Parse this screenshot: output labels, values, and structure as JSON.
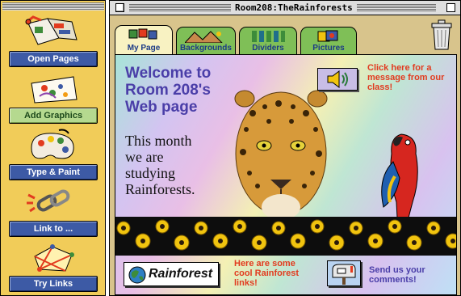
{
  "palette": {
    "tools": [
      {
        "label": "Open Pages",
        "icon": "open-pages-icon"
      },
      {
        "label": "Add Graphics",
        "icon": "add-graphics-icon"
      },
      {
        "label": "Type & Paint",
        "icon": "paint-palette-icon"
      },
      {
        "label": "Link to ...",
        "icon": "chain-link-icon"
      },
      {
        "label": "Try Links",
        "icon": "try-links-icon"
      }
    ],
    "active_tool": "Add Graphics"
  },
  "window": {
    "title": "Room208:TheRainforests",
    "tabs": [
      {
        "label": "My Page",
        "selected": true
      },
      {
        "label": "Backgrounds",
        "selected": false
      },
      {
        "label": "Dividers",
        "selected": false
      },
      {
        "label": "Pictures",
        "selected": false
      }
    ]
  },
  "page": {
    "welcome_line1": "Welcome to",
    "welcome_line2": "Room 208's",
    "welcome_line3": "Web page",
    "month_line1": "This month",
    "month_line2": "we are",
    "month_line3": "studying",
    "month_line4": "Rainforests.",
    "message_prompt": "Click here for a message from our class!",
    "rainforest_button": "Rainforest",
    "links_prompt": "Here are some cool Rainforest links!",
    "comments_prompt": "Send us your comments!"
  },
  "colors": {
    "palette_bg": "#f1cc59",
    "button_blue": "#3d5aa5",
    "button_active": "#b5d98f",
    "heading_purple": "#4a3ea8",
    "prompt_red": "#e23b1f"
  }
}
